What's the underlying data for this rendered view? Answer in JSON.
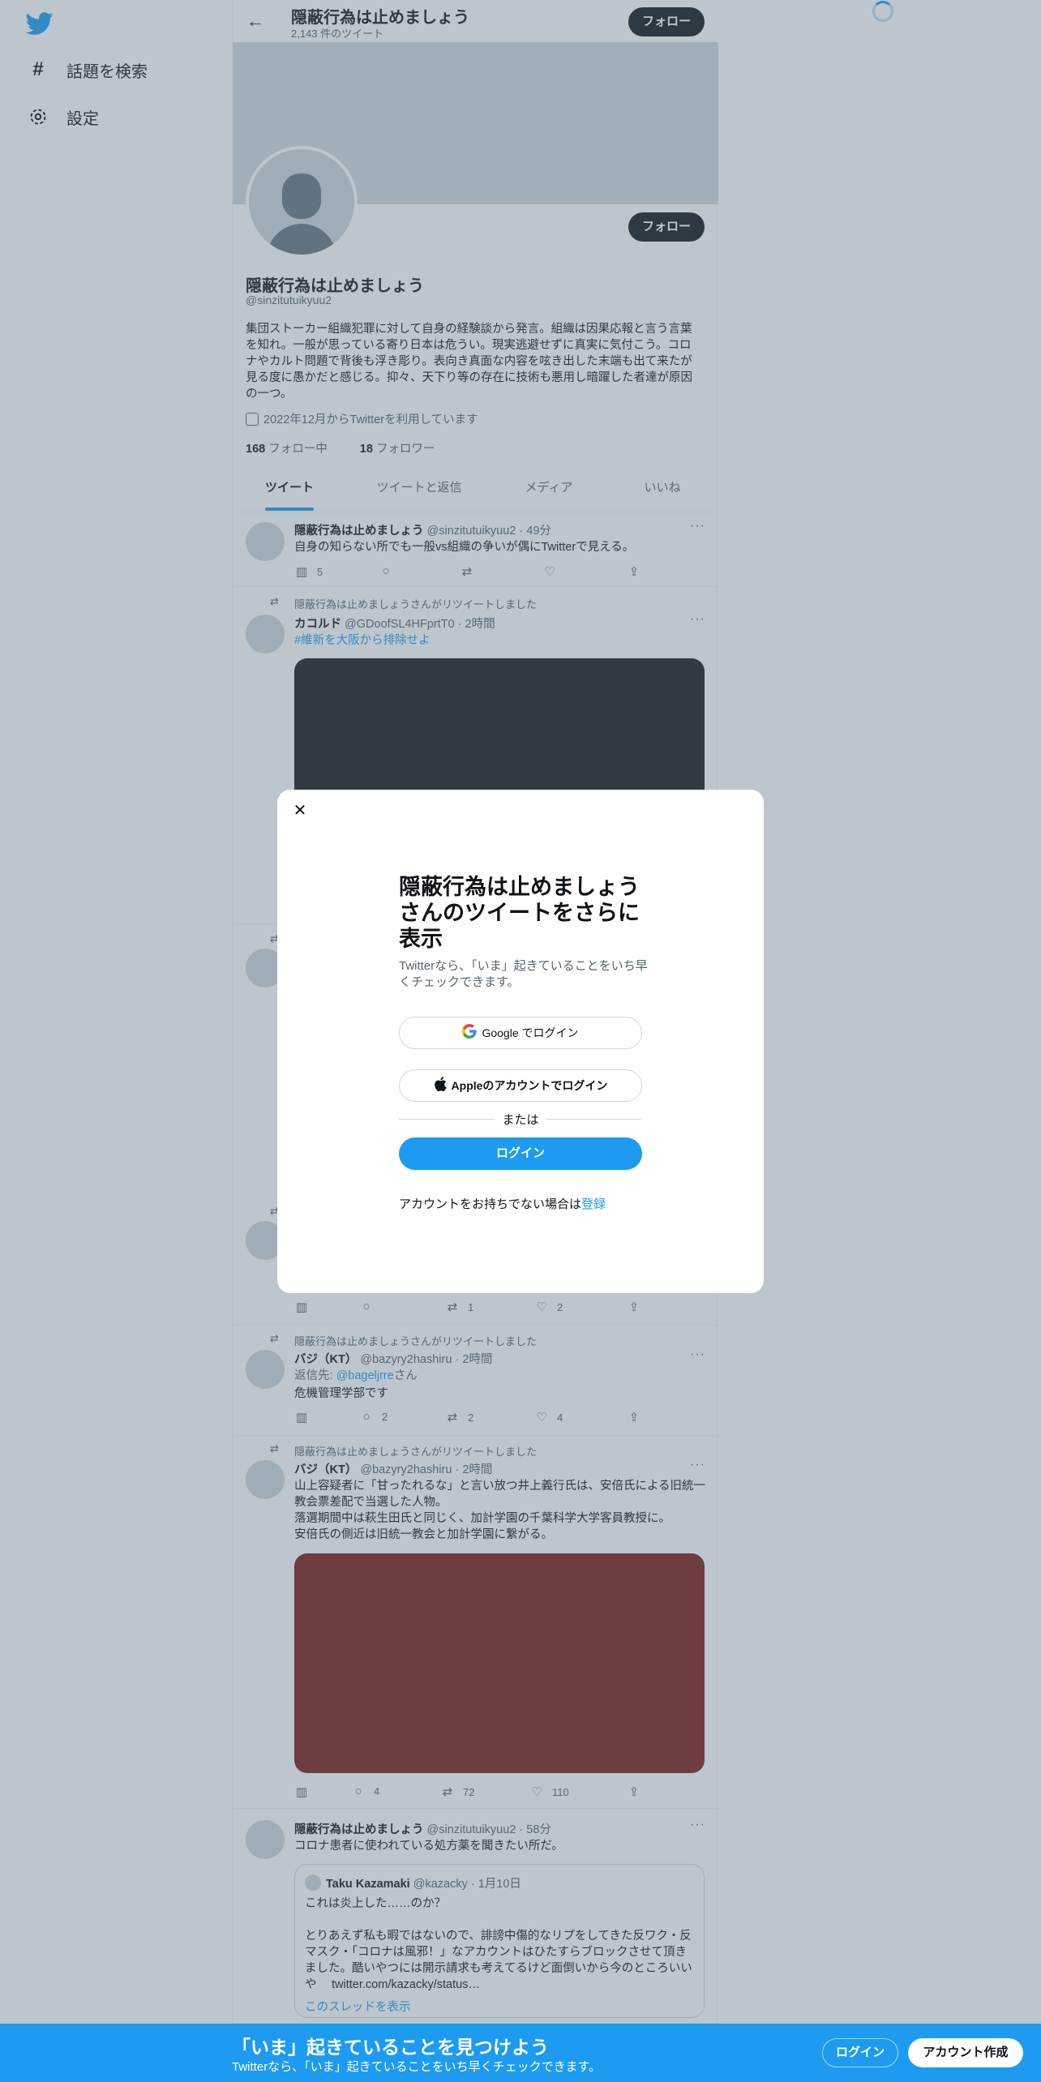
{
  "nav": {
    "logo": "twitter-bird",
    "items": [
      {
        "label": "話題を検索",
        "icon": "hashtag-icon"
      },
      {
        "label": "設定",
        "icon": "gear-icon"
      }
    ]
  },
  "header": {
    "title": "隠蔽行為は止めましょう",
    "subtitle": "2,143 件のツイート",
    "follow_label": "フォロー"
  },
  "profile": {
    "name": "隠蔽行為は止めましょう",
    "handle": "@sinzitutuikyuu2",
    "bio": "集団ストーカー組織犯罪に対して自身の経験談から発言。組織は因果応報と言う言葉を知れ。一般が思っている寄り日本は危うい。現実逃避せずに真実に気付こう。コロナやカルト問題で背後も浮き彫り。表向き真面な内容を呟き出した末端も出て来たが見る度に愚かだと感じる。抑々、天下り等の存在に技術も悪用し暗躍した者達が原因の一つ。",
    "joined": "2022年12月からTwitterを利用しています",
    "following_count": "168",
    "following_label": "フォロー中",
    "followers_count": "18",
    "followers_label": "フォロワー",
    "follow_label": "フォロー"
  },
  "tabs": [
    "ツイート",
    "ツイートと返信",
    "メディア",
    "いいね"
  ],
  "tweets": [
    {
      "name": "隠蔽行為は止めましょう",
      "handle": "@sinzitutuikyuu2",
      "time": "49分",
      "text": "自身の知らない所でも一般vs組織の争いが偶にTwitterで見える。",
      "views": "5",
      "replies": "",
      "retweets": "",
      "likes": ""
    },
    {
      "retweeted_by": "隠蔽行為は止めましょうさんがリツイートしました",
      "name": "カコルド",
      "handle": "@GDoofSL4HFprtT0",
      "time": "2時間",
      "text": "#維新を大阪から排除せよ"
    },
    {
      "retweeted_by": "",
      "views": "",
      "replies": "",
      "retweets": "1",
      "likes": "2"
    },
    {
      "retweeted_by": "隠蔽行為は止めましょうさんがリツイートしました",
      "name": "バジ（KT）",
      "handle": "@bazyry2hashiru",
      "time": "2時間",
      "reply_prefix": "返信先:",
      "reply_to": "@bageljrre",
      "reply_suffix": "さん",
      "text": "危機管理学部です",
      "views": "",
      "replies": "2",
      "retweets": "2",
      "likes": "4"
    },
    {
      "retweeted_by": "隠蔽行為は止めましょうさんがリツイートしました",
      "name": "バジ（KT）",
      "handle": "@bazyry2hashiru",
      "time": "2時間",
      "text": "山上容疑者に「甘ったれるな」と言い放つ井上義行氏は、安倍氏による旧統一教会票差配で当選した人物。\n落選期間中は萩生田氏と同じく、加計学園の千葉科学大学客員教授に。\n安倍氏の側近は旧統一教会と加計学園に繋がる。",
      "views": "",
      "replies": "4",
      "retweets": "72",
      "likes": "110"
    },
    {
      "name": "隠蔽行為は止めましょう",
      "handle": "@sinzitutuikyuu2",
      "time": "58分",
      "text": "コロナ患者に使われている処方薬を聞きたい所だ。",
      "quote": {
        "name": "Taku Kazamaki",
        "handle": "@kazacky",
        "time": "1月10日",
        "text": "これは炎上した……のか？\n\nとりあえず私も暇ではないので、誹謗中傷的なリプをしてきた反ワク・反マスク・「コロナは風邪！」なアカウントはひたすらブロックさせて頂きました。酷いやつには開示請求も考えてるけど面倒いから今のところいいや　 twitter.com/kazacky/status…",
        "thread_link": "このスレッドを表示"
      }
    }
  ],
  "modal": {
    "title": "隠蔽行為は止めましょうさんのツイートをさらに表示",
    "subtitle": "Twitterなら、「いま」起きていることをいち早くチェックできます。",
    "google_label": "Google でログイン",
    "apple_label": "Appleのアカウントでログイン",
    "or_label": "または",
    "login_label": "ログイン",
    "no_account": "アカウントをお持ちでない場合は",
    "signup_link": "登録"
  },
  "bottom_bar": {
    "title": "「いま」起きていることを見つけよう",
    "subtitle": "Twitterなら、「いま」起きていることをいち早くチェックできます。",
    "login_label": "ログイン",
    "signup_label": "アカウント作成"
  },
  "colors": {
    "accent": "#1d9bf0",
    "text": "#0f1419",
    "muted": "#536471",
    "media_dark": "#16181c",
    "media_red": "#7a1c15"
  }
}
